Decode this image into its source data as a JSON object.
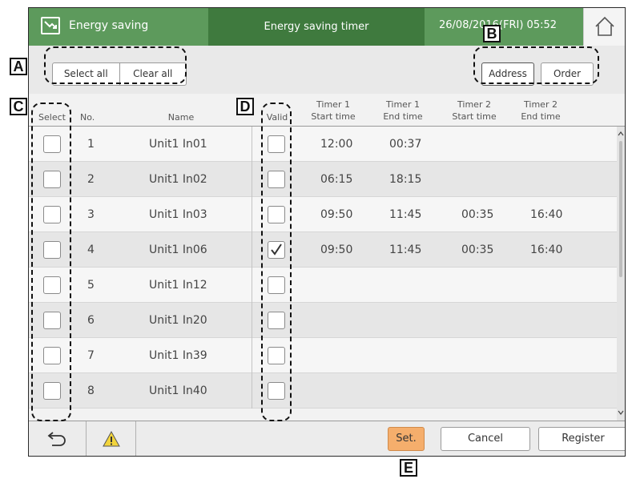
{
  "header": {
    "app_title": "Energy saving",
    "screen_title": "Energy saving timer",
    "datetime": "26/08/2016(FRI) 05:52"
  },
  "toolbar": {
    "select_all_label": "Select all",
    "clear_all_label": "Clear all",
    "sort_address_label": "Address",
    "sort_order_label": "Order",
    "active_sort": "Address"
  },
  "table": {
    "col_select": "Select",
    "col_no": "No.",
    "col_name": "Name",
    "col_valid": "Valid",
    "col_t1_start_1": "Timer 1",
    "col_t1_start_2": "Start time",
    "col_t1_end_1": "Timer 1",
    "col_t1_end_2": "End time",
    "col_t2_start_1": "Timer 2",
    "col_t2_start_2": "Start time",
    "col_t2_end_1": "Timer 2",
    "col_t2_end_2": "End time",
    "rows": [
      {
        "no": "1",
        "name": "Unit1 In01",
        "selected": false,
        "valid": false,
        "t1_start": "12:00",
        "t1_end": "00:37",
        "t2_start": "",
        "t2_end": ""
      },
      {
        "no": "2",
        "name": "Unit1 In02",
        "selected": false,
        "valid": false,
        "t1_start": "06:15",
        "t1_end": "18:15",
        "t2_start": "",
        "t2_end": ""
      },
      {
        "no": "3",
        "name": "Unit1 In03",
        "selected": false,
        "valid": false,
        "t1_start": "09:50",
        "t1_end": "11:45",
        "t2_start": "00:35",
        "t2_end": "16:40"
      },
      {
        "no": "4",
        "name": "Unit1 In06",
        "selected": false,
        "valid": true,
        "t1_start": "09:50",
        "t1_end": "11:45",
        "t2_start": "00:35",
        "t2_end": "16:40"
      },
      {
        "no": "5",
        "name": "Unit1 In12",
        "selected": false,
        "valid": false,
        "t1_start": "",
        "t1_end": "",
        "t2_start": "",
        "t2_end": ""
      },
      {
        "no": "6",
        "name": "Unit1 In20",
        "selected": false,
        "valid": false,
        "t1_start": "",
        "t1_end": "",
        "t2_start": "",
        "t2_end": ""
      },
      {
        "no": "7",
        "name": "Unit1 In39",
        "selected": false,
        "valid": false,
        "t1_start": "",
        "t1_end": "",
        "t2_start": "",
        "t2_end": ""
      },
      {
        "no": "8",
        "name": "Unit1 In40",
        "selected": false,
        "valid": false,
        "t1_start": "",
        "t1_end": "",
        "t2_start": "",
        "t2_end": ""
      }
    ]
  },
  "footer": {
    "set_label": "Set.",
    "cancel_label": "Cancel",
    "register_label": "Register"
  },
  "callouts": {
    "a": "A",
    "b": "B",
    "c": "C",
    "d": "D",
    "e": "E"
  },
  "icons": {
    "app": "energy-saving-icon",
    "home": "home-icon",
    "back": "back-icon",
    "warning": "warning-icon",
    "check": "check-icon"
  },
  "colors": {
    "header_green": "#5d9a5c",
    "header_dark_green": "#3f7a3e",
    "set_orange": "#f5ae6c",
    "warning_yellow": "#f2d43b"
  }
}
